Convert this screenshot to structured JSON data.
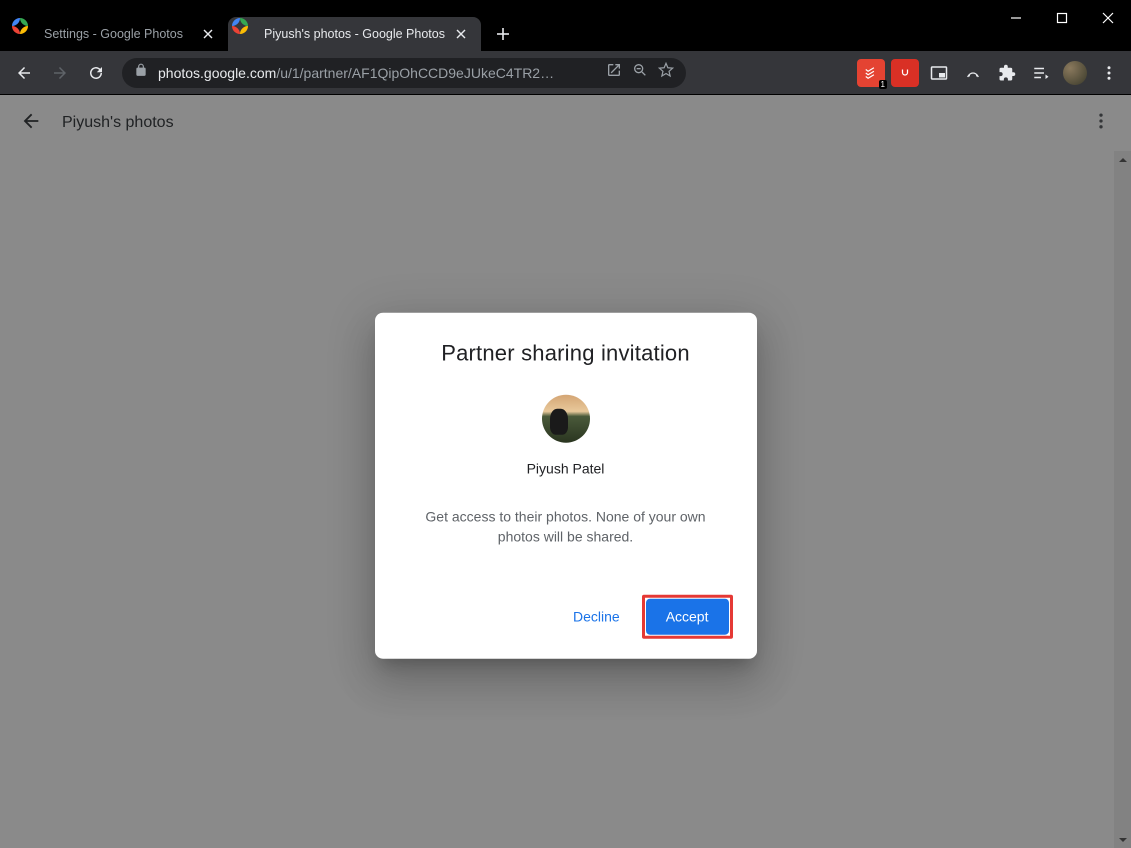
{
  "window": {
    "minimize": "min",
    "maximize": "max",
    "close": "close"
  },
  "tabs": [
    {
      "label": "Settings - Google Photos",
      "active": false
    },
    {
      "label": "Piyush's photos - Google Photos",
      "active": true
    }
  ],
  "url_display": "photos.google.com/u/1/partner/AF1QipOhCCD9eJUkeC4TR2…",
  "url_host": "photos.google.com",
  "url_path": "/u/1/partner/AF1QipOhCCD9eJUkeC4TR2…",
  "ext_badge": "1",
  "page": {
    "title": "Piyush's photos"
  },
  "modal": {
    "title": "Partner sharing invitation",
    "partner_name": "Piyush Patel",
    "description": "Get access to their photos. None of your own photos will be shared.",
    "decline_label": "Decline",
    "accept_label": "Accept"
  }
}
